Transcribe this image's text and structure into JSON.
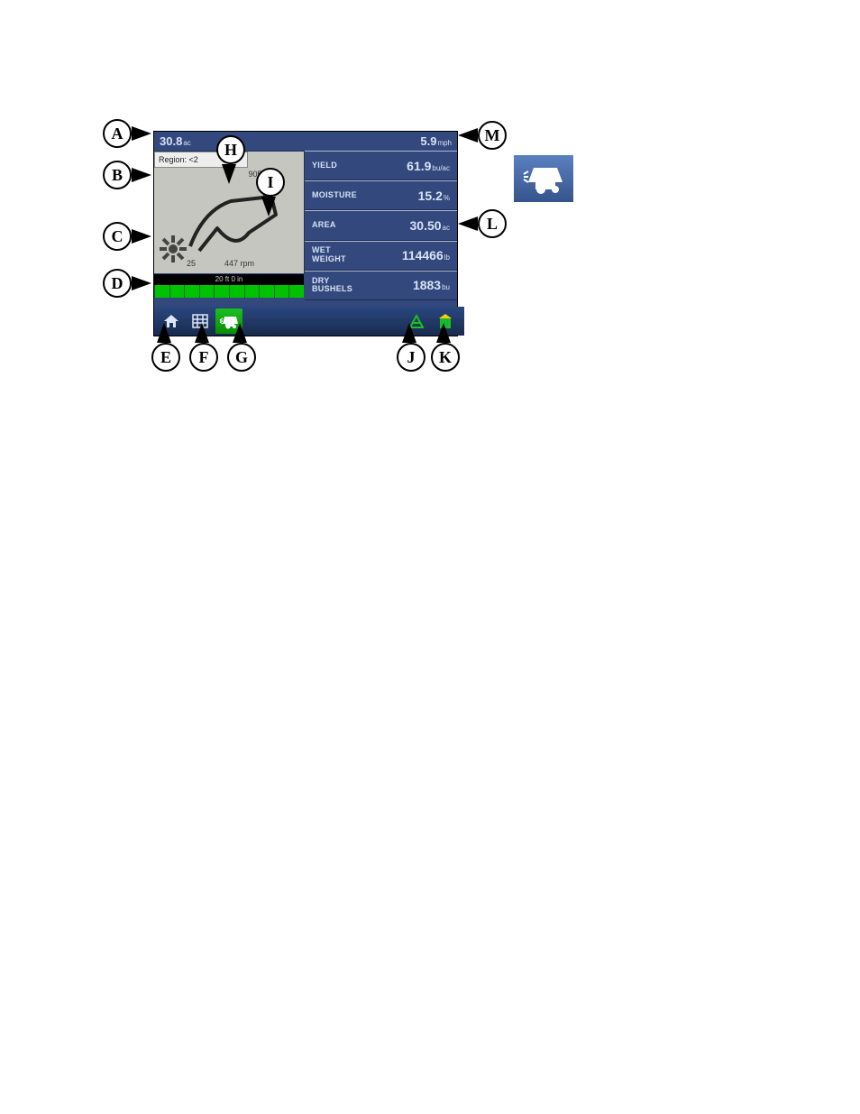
{
  "top": {
    "area_val": "30.8",
    "area_unit": "ac",
    "speed_val": "5.9",
    "speed_unit": "mph"
  },
  "region": {
    "label": "Region: <2"
  },
  "map": {
    "right_val": "905 bu",
    "bl_val": "25",
    "bc_val": "447 rpm"
  },
  "rows": [
    {
      "label": "YIELD",
      "value": "61.9",
      "unit": "bu/ac"
    },
    {
      "label": "MOISTURE",
      "value": "15.2",
      "unit": "%"
    },
    {
      "label": "AREA",
      "value": "30.50",
      "unit": "ac"
    },
    {
      "label": "WET WEIGHT",
      "value": "114466",
      "unit": "lb"
    },
    {
      "label": "DRY BUSHELS",
      "value": "1883",
      "unit": "bu"
    }
  ],
  "swath": {
    "label": "20 ft 0 in"
  },
  "callouts": {
    "A": "A",
    "B": "B",
    "C": "C",
    "D": "D",
    "E": "E",
    "F": "F",
    "G": "G",
    "H": "H",
    "I": "I",
    "J": "J",
    "K": "K",
    "L": "L",
    "M": "M"
  }
}
